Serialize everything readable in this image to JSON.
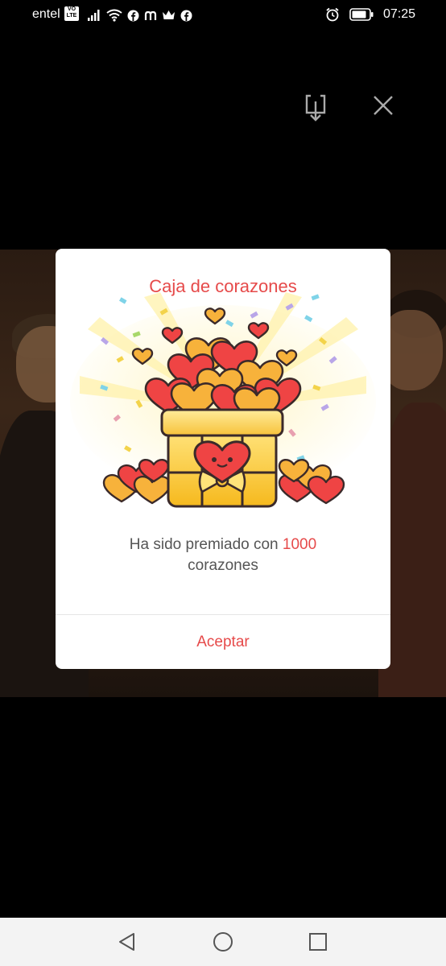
{
  "status_bar": {
    "carrier": "entel",
    "volte_top": "VO",
    "volte_bottom": "LTE",
    "time": "07:25",
    "icons": [
      "signal-icon",
      "wifi-icon",
      "facebook-icon",
      "messenger-icon",
      "crown-icon",
      "facebook-icon",
      "alarm-icon",
      "battery-icon"
    ]
  },
  "top_actions": {
    "download_icon": "download-icon",
    "close_icon": "close-icon"
  },
  "dialog": {
    "title": "Caja de corazones",
    "message_prefix": "Ha sido premiado con ",
    "amount": "1000",
    "message_suffix": "corazones",
    "accept_label": "Aceptar",
    "accent_color": "#e64a4a"
  },
  "nav_bar": {
    "back_icon": "back-triangle-icon",
    "home_icon": "home-circle-icon",
    "recent_icon": "recents-square-icon"
  }
}
